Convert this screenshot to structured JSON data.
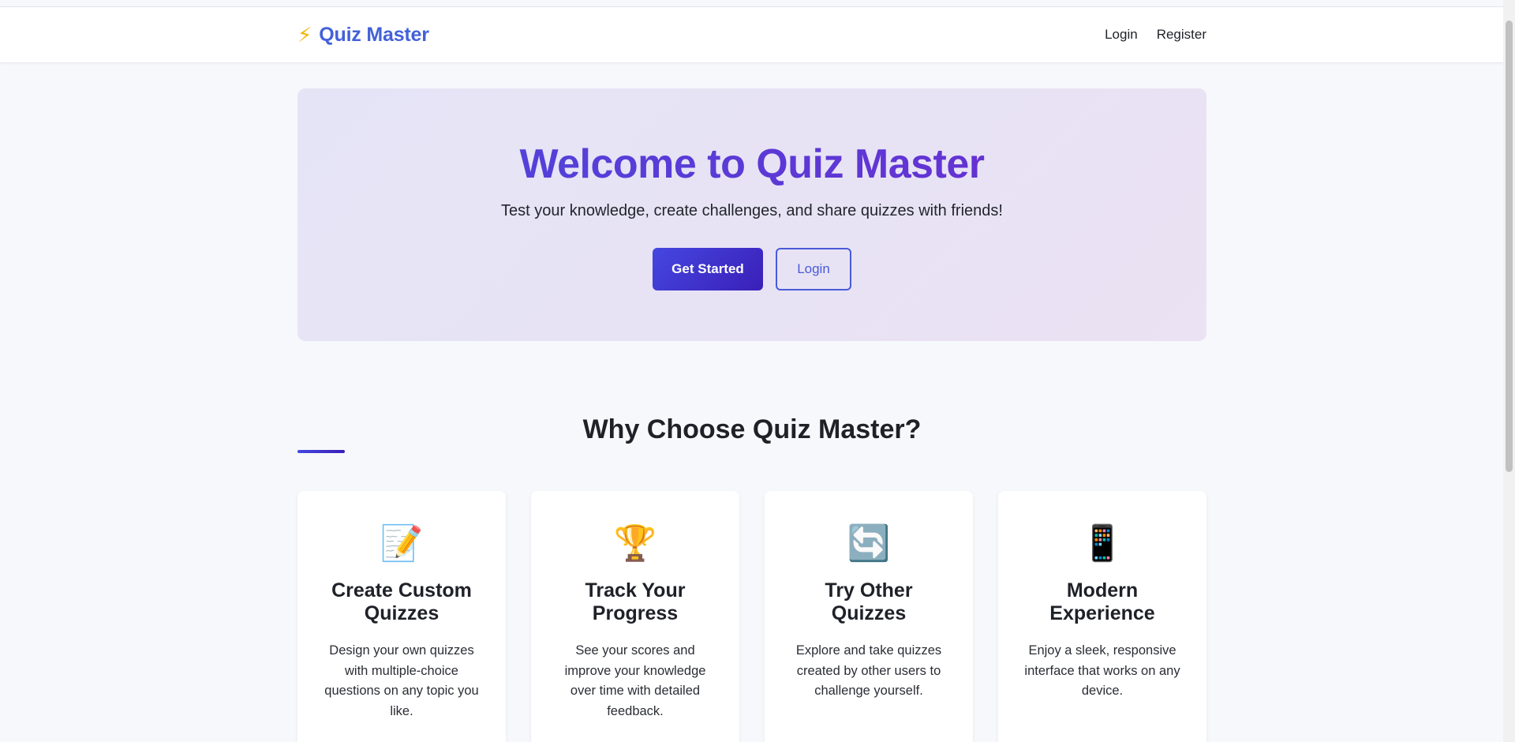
{
  "header": {
    "logo_icon": "⚡",
    "logo_text": "Quiz Master",
    "nav": {
      "login": "Login",
      "register": "Register"
    }
  },
  "hero": {
    "title": "Welcome to Quiz Master",
    "subtitle": "Test your knowledge, create challenges, and share quizzes with friends!",
    "primary_button": "Get Started",
    "secondary_button": "Login"
  },
  "features": {
    "title": "Why Choose Quiz Master?",
    "cards": [
      {
        "icon": "📝",
        "icon_name": "memo-icon",
        "title": "Create Custom Quizzes",
        "description": "Design your own quizzes with multiple-choice questions on any topic you like."
      },
      {
        "icon": "🏆",
        "icon_name": "trophy-icon",
        "title": "Track Your Progress",
        "description": "See your scores and improve your knowledge over time with detailed feedback."
      },
      {
        "icon": "🔄",
        "icon_name": "refresh-icon",
        "title": "Try Other Quizzes",
        "description": "Explore and take quizzes created by other users to challenge yourself."
      },
      {
        "icon": "📱",
        "icon_name": "mobile-phone-icon",
        "title": "Modern Experience",
        "description": "Enjoy a sleek, responsive interface that works on any device."
      }
    ]
  },
  "colors": {
    "brand": "#4361d8",
    "accent_start": "#4547e0",
    "accent_end": "#3a1fb8",
    "background": "#f7f8fb"
  }
}
